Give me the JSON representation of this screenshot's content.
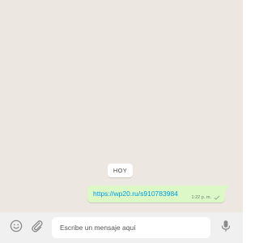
{
  "chat": {
    "date_chip": "HOY",
    "messages": [
      {
        "text": "https://wp20.ru/s910783984",
        "time": "1:22 p. m.",
        "status_icon": "single-check-icon",
        "direction": "outgoing"
      }
    ]
  },
  "footer": {
    "emoji_icon": "emoji-icon",
    "attach_icon": "paperclip-icon",
    "input_placeholder": "Escribe un mensaje aquí",
    "mic_icon": "microphone-icon"
  },
  "colors": {
    "chat_background": "#ece7e0",
    "outgoing_bubble": "#dcf8c6",
    "link": "#039be5",
    "footer_background": "#f0f0f0",
    "icon": "#8a8a8a"
  }
}
